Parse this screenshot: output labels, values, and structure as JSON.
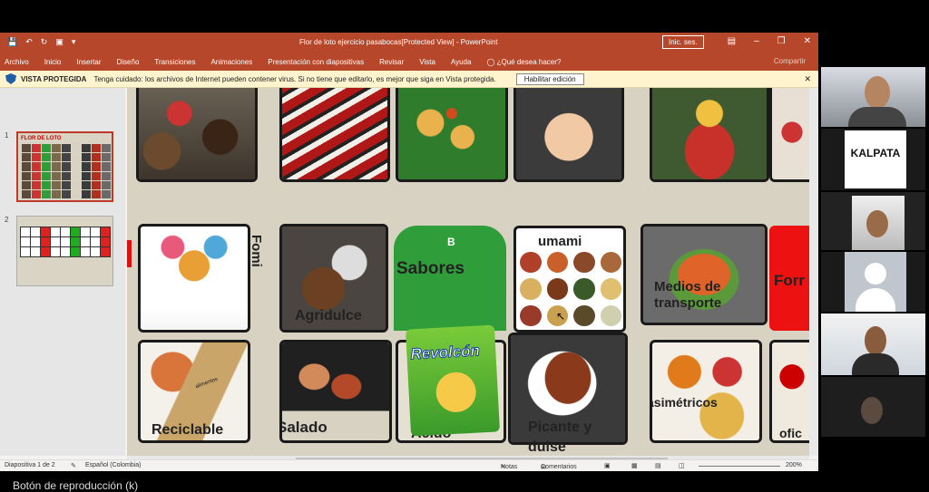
{
  "window": {
    "title": "Flor de loto ejercicio pasabocas[Protected View] - PowerPoint",
    "signin": "Inic. ses.",
    "share": "Compartir"
  },
  "ribbon": {
    "tabs": [
      "Archivo",
      "Inicio",
      "Insertar",
      "Diseño",
      "Transiciones",
      "Animaciones",
      "Presentación con diapositivas",
      "Revisar",
      "Vista",
      "Ayuda"
    ],
    "tell_me": "¿Qué desea hacer?"
  },
  "message_bar": {
    "label": "VISTA PROTEGIDA",
    "text": "Tenga cuidado: los archivos de Internet pueden contener virus. Si no tiene que editarlo, es mejor que siga en Vista protegida.",
    "button": "Habilitar edición"
  },
  "thumbnails": [
    {
      "number": "1",
      "title": "FLOR DE LOTO"
    },
    {
      "number": "2",
      "title": ""
    }
  ],
  "slide": {
    "labels": {
      "fomi": "Fomi",
      "agridulce": "Agridulce",
      "b": "B",
      "sabores": "Sabores",
      "umami": "umami",
      "medios": "Medios de transporte",
      "forma": "Forr",
      "reciclable": "Reciclable",
      "salado": "Salado",
      "acido": "Acido",
      "picante": "Picante y dulse",
      "asimetricos": "asimétricos",
      "ofic": "ofic"
    },
    "snack_brand": "Revolcón",
    "card_brand": "alimentos"
  },
  "status": {
    "slide": "Diapositiva 1 de 2",
    "language": "Español (Colombia)",
    "notes": "Notas",
    "comments": "Comentarios",
    "zoom": "200%"
  },
  "video": {
    "kalpata": "KALPATA"
  },
  "caption": "Botón de reproducción (k)"
}
